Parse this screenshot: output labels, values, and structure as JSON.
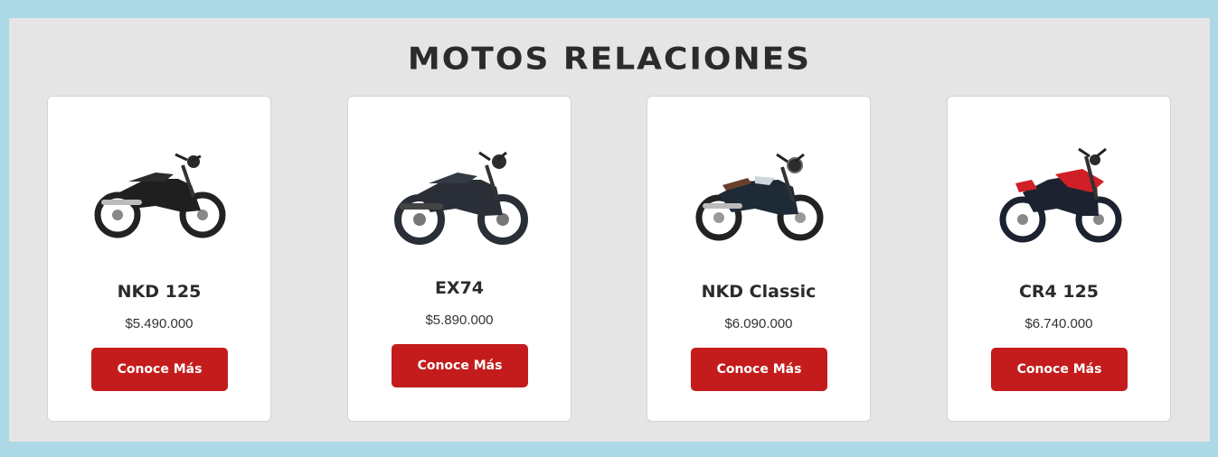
{
  "section": {
    "title": "MOTOS RELACIONES"
  },
  "cards": [
    {
      "name": "NKD 125",
      "price": "$5.490.000",
      "button": "Conoce Más",
      "image_icon": "motorcycle-icon",
      "accent": "#1f1f1f"
    },
    {
      "name": "EX74",
      "price": "$5.890.000",
      "button": "Conoce Más",
      "image_icon": "motorcycle-icon",
      "accent": "#2a2e36"
    },
    {
      "name": "NKD Classic",
      "price": "$6.090.000",
      "button": "Conoce Más",
      "image_icon": "motorcycle-icon",
      "accent": "#1e2a36"
    },
    {
      "name": "CR4 125",
      "price": "$6.740.000",
      "button": "Conoce Más",
      "image_icon": "motorcycle-icon",
      "accent": "#d01f26"
    }
  ],
  "colors": {
    "page_background": "#add8e6",
    "section_background": "#e5e5e5",
    "button": "#c41c1c",
    "title_text": "#2b2b2b"
  }
}
